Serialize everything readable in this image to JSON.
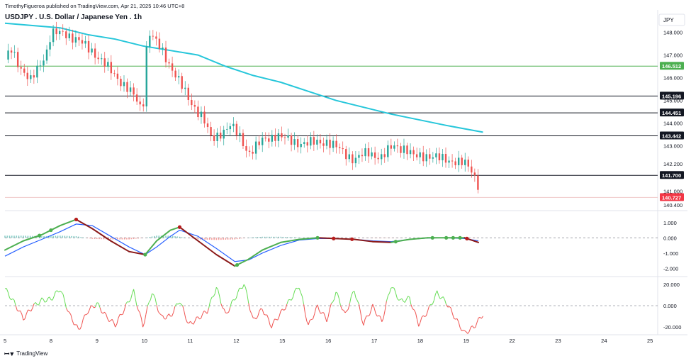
{
  "header": {
    "published": "TimothyFigueroa published on TradingView.com, Apr 21, 2025 10:46 UTC+8",
    "title": "USDJPY . U.S. Dollar / Japanese Yen . 1h",
    "currency": "JPY"
  },
  "footer": {
    "logo_text": "TradingView",
    "logo_icon": "tradingview-logo-icon"
  },
  "colors": {
    "up": "#26a69a",
    "down": "#ef5350",
    "ma": "#26c6da",
    "level": "#131722",
    "green_level": "#4caf50",
    "hist_up": "#26a69a",
    "hist_down": "#ef5350",
    "cci_up": "#66dd55",
    "cci_down": "#ef5350",
    "k_line": "#2962ff"
  },
  "chart_data": [
    {
      "type": "candlestick",
      "x_ticks": [
        "5",
        "8",
        "9",
        "10",
        "11",
        "12",
        "15",
        "16",
        "17",
        "18",
        "19",
        "22",
        "23",
        "24",
        "25"
      ],
      "y_ticks": [
        148.0,
        147.0,
        146.0,
        145.0,
        144.0,
        143.0,
        142.2,
        141.0,
        140.4
      ],
      "ylim": [
        140.3,
        148.8
      ],
      "price_line_labels": [
        {
          "value": 146.512,
          "label": "146.512",
          "style": "green"
        },
        {
          "value": 145.196,
          "label": "145.196",
          "style": "black"
        },
        {
          "value": 144.451,
          "label": "144.451",
          "style": "black"
        },
        {
          "value": 143.442,
          "label": "143.442",
          "style": "black"
        },
        {
          "value": 141.7,
          "label": "141.700",
          "style": "black"
        },
        {
          "value": 140.727,
          "label": "140.727",
          "style": "current"
        }
      ],
      "close_path": [
        [
          0,
          146.8
        ],
        [
          0.15,
          147.3
        ],
        [
          0.35,
          146.4
        ],
        [
          0.55,
          145.8
        ],
        [
          0.75,
          146.6
        ],
        [
          0.9,
          147.1
        ],
        [
          1.0,
          147.9
        ],
        [
          1.3,
          148.0
        ],
        [
          1.6,
          147.6
        ],
        [
          1.9,
          147.2
        ],
        [
          2.2,
          146.5
        ],
        [
          2.5,
          145.9
        ],
        [
          2.8,
          145.2
        ],
        [
          3.0,
          144.5
        ],
        [
          3.05,
          147.0
        ],
        [
          3.15,
          148.0
        ],
        [
          3.4,
          147.2
        ],
        [
          3.7,
          146.2
        ],
        [
          4.0,
          145.0
        ],
        [
          4.3,
          144.3
        ],
        [
          4.5,
          143.2
        ],
        [
          4.7,
          143.6
        ],
        [
          4.9,
          143.9
        ],
        [
          5.1,
          143.4
        ],
        [
          5.3,
          142.7
        ],
        [
          5.6,
          143.2
        ],
        [
          5.9,
          143.5
        ],
        [
          6.2,
          143.2
        ],
        [
          6.6,
          143.1
        ],
        [
          7.0,
          143.2
        ],
        [
          7.3,
          142.8
        ],
        [
          7.6,
          142.4
        ],
        [
          7.9,
          142.7
        ],
        [
          8.2,
          142.5
        ],
        [
          8.45,
          143.0
        ],
        [
          8.7,
          142.9
        ],
        [
          8.9,
          142.5
        ],
        [
          9.2,
          142.6
        ],
        [
          9.5,
          142.4
        ],
        [
          9.8,
          142.35
        ],
        [
          10.0,
          142.2
        ],
        [
          10.15,
          141.9
        ],
        [
          10.3,
          141.3
        ]
      ],
      "ma_path": [
        [
          0,
          148.4
        ],
        [
          0.6,
          148.3
        ],
        [
          1.2,
          148.2
        ],
        [
          1.8,
          147.9
        ],
        [
          2.4,
          147.7
        ],
        [
          3.0,
          147.4
        ],
        [
          3.6,
          147.2
        ],
        [
          4.2,
          147.0
        ],
        [
          4.8,
          146.5
        ],
        [
          5.4,
          146.1
        ],
        [
          6.0,
          145.8
        ],
        [
          6.6,
          145.4
        ],
        [
          7.2,
          145.0
        ],
        [
          7.8,
          144.7
        ],
        [
          8.4,
          144.4
        ],
        [
          9.0,
          144.15
        ],
        [
          9.6,
          143.9
        ],
        [
          10.0,
          143.75
        ],
        [
          10.4,
          143.6
        ]
      ],
      "x_range": [
        0,
        14.2
      ]
    },
    {
      "type": "oscillator",
      "y_ticks": [
        1.0,
        0.0,
        -1.0,
        -2.0
      ],
      "ylim": [
        -2.4,
        1.5
      ],
      "signal_path": [
        [
          0,
          -0.8
        ],
        [
          0.4,
          -0.2
        ],
        [
          0.8,
          0.2
        ],
        [
          1.2,
          0.8
        ],
        [
          1.55,
          1.2
        ],
        [
          1.9,
          0.6
        ],
        [
          2.3,
          -0.2
        ],
        [
          2.7,
          -0.9
        ],
        [
          3.05,
          -1.1
        ],
        [
          3.3,
          -0.2
        ],
        [
          3.6,
          0.5
        ],
        [
          3.8,
          0.7
        ],
        [
          4.2,
          -0.2
        ],
        [
          4.6,
          -1.1
        ],
        [
          5.0,
          -1.85
        ],
        [
          5.3,
          -1.4
        ],
        [
          5.6,
          -0.8
        ],
        [
          6.0,
          -0.3
        ],
        [
          6.4,
          -0.1
        ],
        [
          6.8,
          0.0
        ],
        [
          7.2,
          -0.05
        ],
        [
          7.6,
          -0.1
        ],
        [
          8.0,
          -0.25
        ],
        [
          8.4,
          -0.3
        ],
        [
          8.8,
          -0.1
        ],
        [
          9.2,
          0.0
        ],
        [
          9.6,
          0.0
        ],
        [
          10.0,
          0.0
        ],
        [
          10.3,
          -0.3
        ]
      ],
      "k_path": [
        [
          0,
          -1.2
        ],
        [
          0.4,
          -0.6
        ],
        [
          0.8,
          -0.1
        ],
        [
          1.2,
          0.4
        ],
        [
          1.55,
          0.9
        ],
        [
          1.9,
          0.8
        ],
        [
          2.3,
          0.1
        ],
        [
          2.7,
          -0.6
        ],
        [
          3.05,
          -1.1
        ],
        [
          3.3,
          -0.6
        ],
        [
          3.6,
          0.1
        ],
        [
          3.8,
          0.5
        ],
        [
          4.2,
          0.1
        ],
        [
          4.6,
          -0.7
        ],
        [
          5.0,
          -1.55
        ],
        [
          5.3,
          -1.45
        ],
        [
          5.6,
          -1.0
        ],
        [
          6.0,
          -0.5
        ],
        [
          6.4,
          -0.15
        ],
        [
          6.8,
          -0.05
        ],
        [
          7.2,
          -0.05
        ],
        [
          7.6,
          -0.1
        ],
        [
          8.0,
          -0.2
        ],
        [
          8.4,
          -0.25
        ],
        [
          8.8,
          -0.1
        ],
        [
          9.2,
          -0.02
        ],
        [
          9.6,
          0.0
        ],
        [
          10.0,
          -0.05
        ],
        [
          10.3,
          -0.2
        ]
      ],
      "cross_markers": [
        0.75,
        1.0,
        1.55,
        3.05,
        3.8,
        5.05,
        6.8,
        7.15,
        7.55,
        8.5,
        9.3,
        9.6,
        9.75,
        9.9,
        10.05
      ]
    },
    {
      "type": "oscillator",
      "y_ticks": [
        20.0,
        0.0,
        -20.0
      ],
      "ylim": [
        -26,
        26
      ],
      "path": [
        [
          0,
          16
        ],
        [
          0.2,
          3
        ],
        [
          0.4,
          -12
        ],
        [
          0.6,
          -1
        ],
        [
          0.8,
          5
        ],
        [
          1.0,
          6
        ],
        [
          1.2,
          16
        ],
        [
          1.4,
          -8
        ],
        [
          1.6,
          -23
        ],
        [
          1.8,
          -5
        ],
        [
          2.0,
          2
        ],
        [
          2.2,
          -10
        ],
        [
          2.4,
          -18
        ],
        [
          2.6,
          -3
        ],
        [
          2.8,
          13
        ],
        [
          3.0,
          -19
        ],
        [
          3.2,
          13
        ],
        [
          3.4,
          -11
        ],
        [
          3.6,
          -10
        ],
        [
          3.8,
          5
        ],
        [
          4.0,
          -18
        ],
        [
          4.2,
          -12
        ],
        [
          4.4,
          -5
        ],
        [
          4.6,
          17
        ],
        [
          4.8,
          -9
        ],
        [
          5.0,
          7
        ],
        [
          5.2,
          21
        ],
        [
          5.4,
          -14
        ],
        [
          5.6,
          -3
        ],
        [
          5.8,
          -19
        ],
        [
          6.0,
          -7
        ],
        [
          6.2,
          5
        ],
        [
          6.4,
          19
        ],
        [
          6.6,
          -19
        ],
        [
          6.8,
          -1
        ],
        [
          7.0,
          -13
        ],
        [
          7.2,
          13
        ],
        [
          7.4,
          -9
        ],
        [
          7.6,
          15
        ],
        [
          7.8,
          -17
        ],
        [
          8.0,
          -1
        ],
        [
          8.2,
          -15
        ],
        [
          8.4,
          19
        ],
        [
          8.6,
          4
        ],
        [
          8.8,
          7
        ],
        [
          9.0,
          -17
        ],
        [
          9.2,
          -5
        ],
        [
          9.4,
          12
        ],
        [
          9.6,
          3
        ],
        [
          9.8,
          -12
        ],
        [
          10.0,
          -26
        ],
        [
          10.2,
          -20
        ],
        [
          10.4,
          -8
        ]
      ]
    }
  ]
}
